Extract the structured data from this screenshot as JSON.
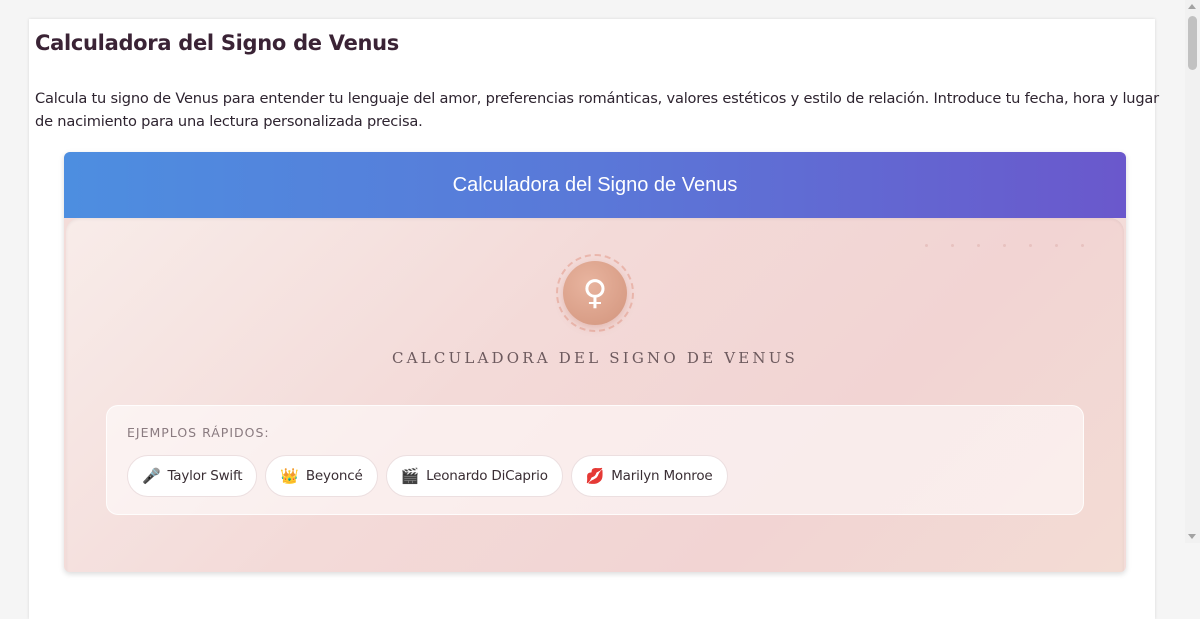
{
  "page": {
    "title": "Calculadora del Signo de Venus",
    "description": "Calcula tu signo de Venus para entender tu lenguaje del amor, preferencias románticas, valores estéticos y estilo de relación. Introduce tu fecha, hora y lugar de nacimiento para una lectura personalizada precisa."
  },
  "card": {
    "header_title": "Calculadora del Signo de Venus",
    "venus_symbol": "♀",
    "subtitle": "CALCULADORA DEL SIGNO DE VENUS"
  },
  "examples": {
    "label": "EJEMPLOS RÁPIDOS:",
    "items": [
      {
        "emoji": "🎤",
        "name": "Taylor Swift"
      },
      {
        "emoji": "👑",
        "name": "Beyoncé"
      },
      {
        "emoji": "🎬",
        "name": "Leonardo DiCaprio"
      },
      {
        "emoji": "💋",
        "name": "Marilyn Monroe"
      }
    ]
  },
  "colors": {
    "header_gradient_start": "#4d8ee0",
    "header_gradient_end": "#6a58cc",
    "venus_circle": "#d99e87",
    "title_text": "#3a2335"
  }
}
